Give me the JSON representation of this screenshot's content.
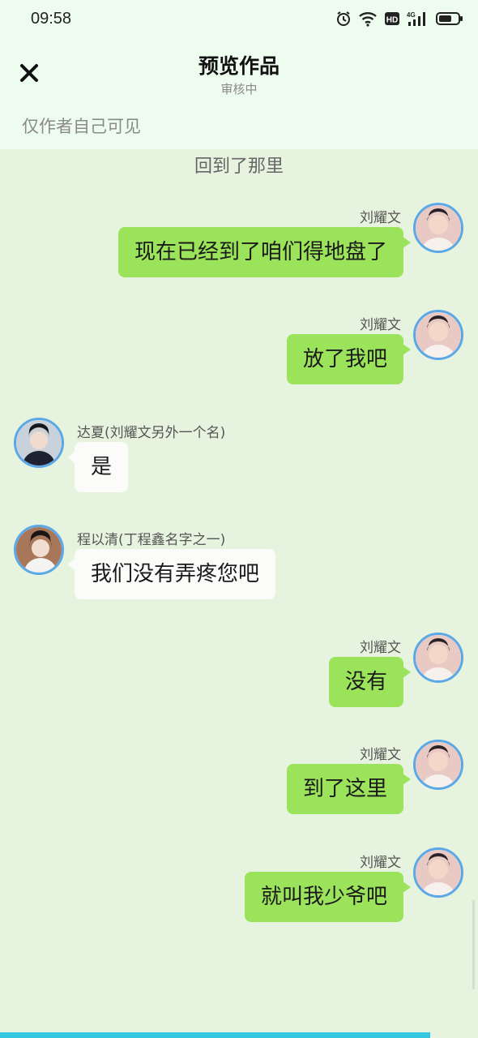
{
  "status_bar": {
    "time": "09:58",
    "icons": [
      "alarm-icon",
      "wifi-icon",
      "hd-icon",
      "4g-signal-icon",
      "battery-icon"
    ],
    "hd": "HD",
    "network": "4G"
  },
  "header": {
    "title": "预览作品",
    "subtitle": "审核中",
    "close_icon": "close-icon"
  },
  "visibility_note": "仅作者自己可见",
  "narration": "回到了那里",
  "messages": [
    {
      "side": "right",
      "sender": "刘耀文",
      "text": "现在已经到了咱们得地盘了"
    },
    {
      "side": "right",
      "sender": "刘耀文",
      "text": "放了我吧"
    },
    {
      "side": "left",
      "sender": "达夏(刘耀文另外一个名)",
      "text": "是"
    },
    {
      "side": "left",
      "sender": "程以清(丁程鑫名字之一)",
      "text": "我们没有弄疼您吧"
    },
    {
      "side": "right",
      "sender": "刘耀文",
      "text": "没有"
    },
    {
      "side": "right",
      "sender": "刘耀文",
      "text": "到了这里"
    },
    {
      "side": "right",
      "sender": "刘耀文",
      "text": "就叫我少爷吧"
    }
  ],
  "progress": {
    "fraction": 0.9
  },
  "colors": {
    "right_bubble": "#9be35a",
    "left_bubble": "#fbfcfa",
    "background": "#e6f3df",
    "avatar_ring": "#5aa9e6",
    "progress": "#35c7e0"
  }
}
